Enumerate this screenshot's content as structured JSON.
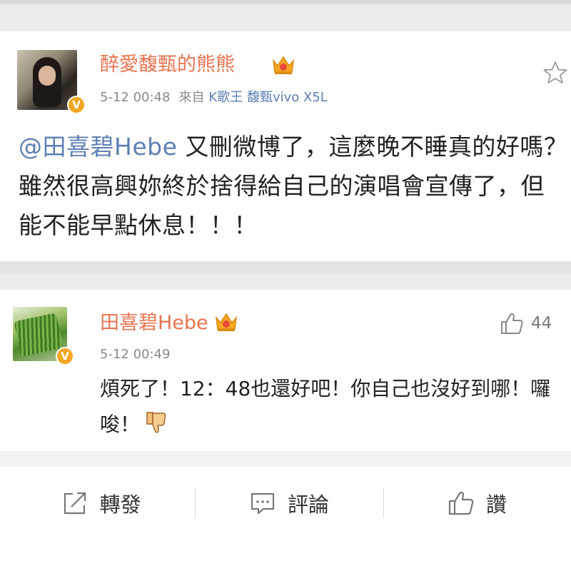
{
  "post": {
    "author": "醉愛馥甄的熊熊",
    "time": "5-12 00:48",
    "from_label": "來自",
    "device": "K歌王 馥甄vivo X5L",
    "mention": "@田喜碧Hebe",
    "text": " 又刪微博了，這麼晚不睡真的好嗎？ 雖然很高興妳終於捨得給自己的演唱會宣傳了，但能不能早點休息！！！",
    "verified_badge": "V",
    "crown_icon": "crown-icon",
    "favorite_icon": "star-icon"
  },
  "reply": {
    "author": "田喜碧Hebe",
    "time": "5-12 00:49",
    "likes": "44",
    "text": "煩死了！12：48也還好吧！你自己也沒好到哪！囉唆！",
    "verified_badge": "V",
    "crown_icon": "crown-icon",
    "like_icon": "thumbs-up-icon",
    "emoji_icon": "thumbs-down-emoji"
  },
  "actions": {
    "share": "轉發",
    "comment": "評論",
    "like": "讚"
  },
  "colors": {
    "name": "#eb7350",
    "link": "#5d7fb4",
    "badge": "#f5a623"
  }
}
